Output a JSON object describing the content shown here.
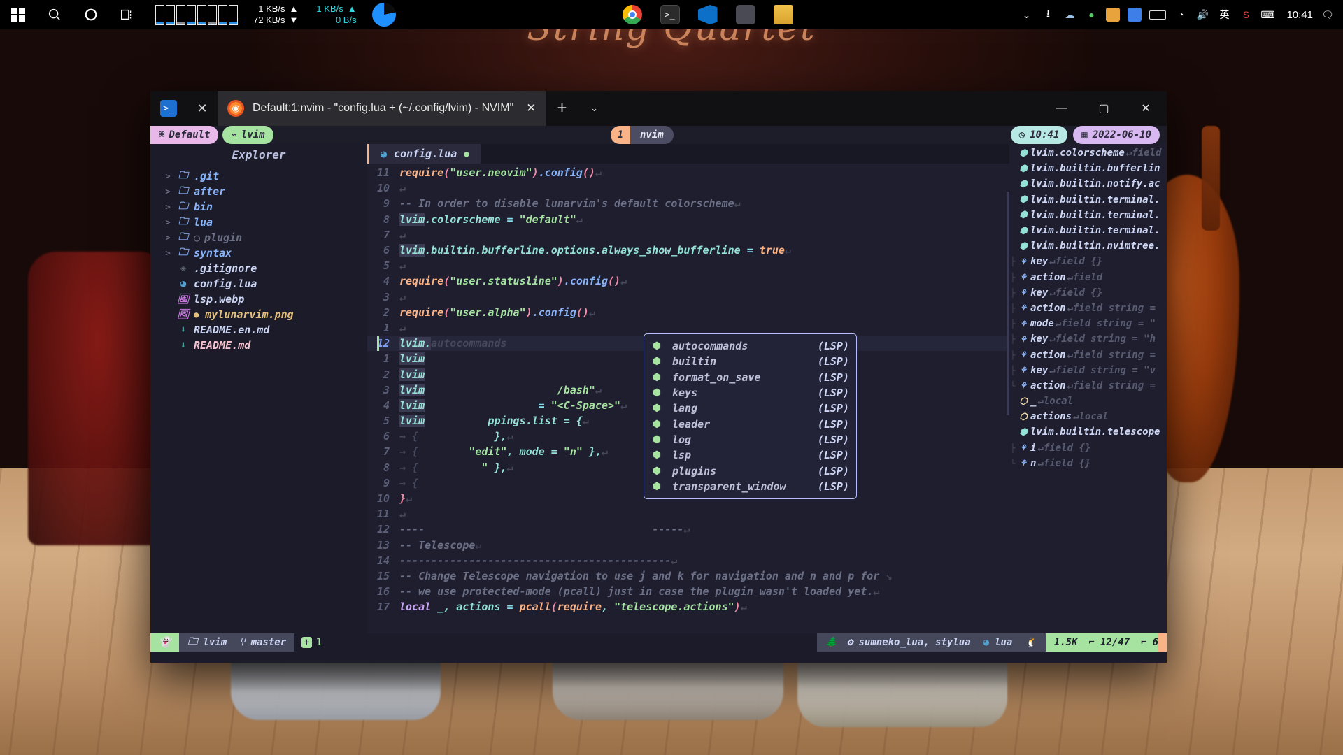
{
  "desktop": {
    "wallpaper_title": "String Quartet"
  },
  "taskbar": {
    "start_label": "⊞",
    "search_label": "search-icon",
    "cortana_label": "cortana-icon",
    "taskview_label": "task-view-icon",
    "net_down_value": "72 KB/s",
    "net_up_value": "1 KB/s",
    "net2_up_value": "1 KB/s",
    "net2_down_value": "0 B/s",
    "arrow_up": "▲",
    "arrow_down": "▼",
    "tray": {
      "chevron": "⌄",
      "ime_label": "英",
      "clock": "10:41"
    },
    "apps": [
      "chrome-icon",
      "terminal-icon",
      "vscode-icon",
      "book-icon",
      "files-icon"
    ]
  },
  "window": {
    "tab_title": "Default:1:nvim - \"config.lua + (~/.config/lvim) - NVIM\"",
    "tab_close": "✕",
    "left_close": "✕",
    "new_tab": "+",
    "dropdown": "⌄",
    "minimize": "—",
    "maximize": "▢",
    "close": "✕"
  },
  "tmux": {
    "session": "Default",
    "window_name": "lvim",
    "pane_number": "1",
    "pane_name": "nvim",
    "clock_icon": "clock-icon",
    "clock": "10:41",
    "date_icon": "calendar-icon",
    "date": "2022-06-10"
  },
  "explorer": {
    "title": "Explorer",
    "items": [
      {
        "arrow": ">",
        "icon": "folder-icon",
        "name": ".git",
        "type": "folder",
        "modified": false
      },
      {
        "arrow": ">",
        "icon": "folder-icon",
        "name": "after",
        "type": "folder",
        "modified": false
      },
      {
        "arrow": ">",
        "icon": "folder-icon",
        "name": "bin",
        "type": "folder",
        "modified": false
      },
      {
        "arrow": ">",
        "icon": "folder-icon",
        "name": "lua",
        "type": "folder",
        "modified": false
      },
      {
        "arrow": ">",
        "icon": "folder-icon",
        "name": "plugin",
        "type": "folder-dim",
        "modified": false,
        "badge": "○"
      },
      {
        "arrow": ">",
        "icon": "folder-icon",
        "name": "syntax",
        "type": "folder",
        "modified": false
      },
      {
        "arrow": "",
        "icon": "git-icon",
        "name": ".gitignore",
        "type": "file",
        "modified": false
      },
      {
        "arrow": "",
        "icon": "lua-icon",
        "name": "config.lua",
        "type": "file",
        "modified": false
      },
      {
        "arrow": "",
        "icon": "image-icon",
        "name": "lsp.webp",
        "type": "file",
        "modified": false
      },
      {
        "arrow": "",
        "icon": "image-icon",
        "name": "mylunarvim.png",
        "type": "file",
        "modified": true,
        "badge": "●"
      },
      {
        "arrow": "",
        "icon": "markdown-icon",
        "name": "README.en.md",
        "type": "file",
        "modified": false
      },
      {
        "arrow": "",
        "icon": "markdown-icon",
        "name": "README.md",
        "type": "file-pink",
        "modified": false
      }
    ]
  },
  "bufferline": {
    "icon": "lua-icon",
    "name": "config.lua",
    "modified_dot": "●"
  },
  "editor": {
    "lines": [
      {
        "num": "11",
        "segments": [
          {
            "t": "require",
            "c": "t-call"
          },
          {
            "t": "(",
            "c": "t-paren"
          },
          {
            "t": "\"user.neovim\"",
            "c": "t-str"
          },
          {
            "t": ")",
            "c": "t-paren"
          },
          {
            "t": ".",
            "c": "t-fn"
          },
          {
            "t": "config",
            "c": "t-fn"
          },
          {
            "t": "()",
            "c": "t-paren"
          },
          {
            "t": "↵",
            "c": "t-ws"
          }
        ]
      },
      {
        "num": "10",
        "segments": [
          {
            "t": "↵",
            "c": "t-ws"
          }
        ]
      },
      {
        "num": "9",
        "segments": [
          {
            "t": "-- In order to disable lunarvim's default colorscheme",
            "c": "t-com"
          },
          {
            "t": "↵",
            "c": "t-ws"
          }
        ]
      },
      {
        "num": "8",
        "segments": [
          {
            "t": "lvim",
            "c": "t-var hl-box"
          },
          {
            "t": ".colorscheme ",
            "c": "t-var"
          },
          {
            "t": "= ",
            "c": "t-op"
          },
          {
            "t": "\"default\"",
            "c": "t-str"
          },
          {
            "t": "↵",
            "c": "t-ws"
          }
        ]
      },
      {
        "num": "7",
        "segments": [
          {
            "t": "↵",
            "c": "t-ws"
          }
        ]
      },
      {
        "num": "6",
        "segments": [
          {
            "t": "lvim",
            "c": "t-var hl-box"
          },
          {
            "t": ".builtin.bufferline.options.always_show_bufferline ",
            "c": "t-var"
          },
          {
            "t": "= ",
            "c": "t-op"
          },
          {
            "t": "true",
            "c": "t-num"
          },
          {
            "t": "↵",
            "c": "t-ws"
          }
        ]
      },
      {
        "num": "5",
        "segments": [
          {
            "t": "↵",
            "c": "t-ws"
          }
        ]
      },
      {
        "num": "4",
        "segments": [
          {
            "t": "require",
            "c": "t-call"
          },
          {
            "t": "(",
            "c": "t-paren"
          },
          {
            "t": "\"user.statusline\"",
            "c": "t-str"
          },
          {
            "t": ")",
            "c": "t-paren"
          },
          {
            "t": ".",
            "c": "t-fn"
          },
          {
            "t": "config",
            "c": "t-fn"
          },
          {
            "t": "()",
            "c": "t-paren"
          },
          {
            "t": "↵",
            "c": "t-ws"
          }
        ]
      },
      {
        "num": "3",
        "segments": [
          {
            "t": "↵",
            "c": "t-ws"
          }
        ]
      },
      {
        "num": "2",
        "segments": [
          {
            "t": "require",
            "c": "t-call"
          },
          {
            "t": "(",
            "c": "t-paren"
          },
          {
            "t": "\"user.alpha\"",
            "c": "t-str"
          },
          {
            "t": ")",
            "c": "t-paren"
          },
          {
            "t": ".",
            "c": "t-fn"
          },
          {
            "t": "config",
            "c": "t-fn"
          },
          {
            "t": "()",
            "c": "t-paren"
          },
          {
            "t": "↵",
            "c": "t-ws"
          }
        ]
      },
      {
        "num": "1",
        "segments": [
          {
            "t": "↵",
            "c": "t-ws"
          }
        ]
      },
      {
        "num": "12",
        "current": true,
        "segments": [
          {
            "t": "lvim.",
            "c": "t-var hl-box"
          },
          {
            "t": "autocommands",
            "c": "t-ws ghost"
          }
        ]
      },
      {
        "num": "1",
        "segments": [
          {
            "t": "lvim",
            "c": "t-var hl-box"
          }
        ]
      },
      {
        "num": "2",
        "segments": [
          {
            "t": "lvim",
            "c": "t-var hl-box"
          }
        ]
      },
      {
        "num": "3",
        "segments": [
          {
            "t": "lvim",
            "c": "t-var hl-box"
          },
          {
            "t": "                     /bash\"",
            "c": "t-str"
          },
          {
            "t": "↵",
            "c": "t-ws"
          }
        ]
      },
      {
        "num": "4",
        "segments": [
          {
            "t": "lvim",
            "c": "t-var hl-box"
          },
          {
            "t": "                  = ",
            "c": "t-op"
          },
          {
            "t": "\"<C-Space>\"",
            "c": "t-str"
          },
          {
            "t": "↵",
            "c": "t-ws"
          }
        ]
      },
      {
        "num": "5",
        "segments": [
          {
            "t": "lvim",
            "c": "t-var hl-box"
          },
          {
            "t": "          ppings.list = {",
            "c": "t-var"
          },
          {
            "t": "↵",
            "c": "t-ws"
          }
        ]
      },
      {
        "num": "6",
        "segments": [
          {
            "t": "→ {",
            "c": "t-ws"
          },
          {
            "t": "            },",
            "c": "t-var"
          },
          {
            "t": "↵",
            "c": "t-ws"
          }
        ]
      },
      {
        "num": "7",
        "segments": [
          {
            "t": "→ {",
            "c": "t-ws"
          },
          {
            "t": "        \"edit\"",
            "c": "t-str"
          },
          {
            "t": ", mode = ",
            "c": "t-var"
          },
          {
            "t": "\"n\"",
            "c": "t-str"
          },
          {
            "t": " },",
            "c": "t-var"
          },
          {
            "t": "↵",
            "c": "t-ws"
          }
        ]
      },
      {
        "num": "8",
        "segments": [
          {
            "t": "→ {",
            "c": "t-ws"
          },
          {
            "t": "          \"",
            "c": "t-str"
          },
          {
            "t": " },",
            "c": "t-var"
          },
          {
            "t": "↵",
            "c": "t-ws"
          }
        ]
      },
      {
        "num": "9",
        "segments": [
          {
            "t": "→ {",
            "c": "t-ws"
          }
        ]
      },
      {
        "num": "10",
        "segments": [
          {
            "t": "}",
            "c": "t-paren"
          },
          {
            "t": "↵",
            "c": "t-ws"
          }
        ]
      },
      {
        "num": "11",
        "segments": [
          {
            "t": "↵",
            "c": "t-ws"
          }
        ]
      },
      {
        "num": "12",
        "segments": [
          {
            "t": "----",
            "c": "t-com"
          },
          {
            "t": "                                    -----",
            "c": "t-com"
          },
          {
            "t": "↵",
            "c": "t-ws"
          }
        ]
      },
      {
        "num": "13",
        "segments": [
          {
            "t": "-- Telescope",
            "c": "t-com"
          },
          {
            "t": "↵",
            "c": "t-ws"
          }
        ]
      },
      {
        "num": "14",
        "segments": [
          {
            "t": "-------------------------------------------",
            "c": "t-com"
          },
          {
            "t": "↵",
            "c": "t-ws"
          }
        ]
      },
      {
        "num": "15",
        "segments": [
          {
            "t": "-- Change Telescope navigation to use j and k for navigation and n and p for ",
            "c": "t-com"
          },
          {
            "t": "↘",
            "c": "t-ws"
          }
        ]
      },
      {
        "num": "16",
        "segments": [
          {
            "t": "-- we use protected-mode (pcall) just in case the plugin wasn't loaded yet.",
            "c": "t-com"
          },
          {
            "t": "↵",
            "c": "t-ws"
          }
        ]
      },
      {
        "num": "17",
        "segments": [
          {
            "t": "local",
            "c": "t-local"
          },
          {
            "t": " _, ",
            "c": "t-var"
          },
          {
            "t": "actions",
            "c": "t-var"
          },
          {
            "t": " = ",
            "c": "t-op"
          },
          {
            "t": "pcall",
            "c": "t-call"
          },
          {
            "t": "(",
            "c": "t-paren"
          },
          {
            "t": "require",
            "c": "t-call"
          },
          {
            "t": ", ",
            "c": "t-var"
          },
          {
            "t": "\"telescope.actions\"",
            "c": "t-str"
          },
          {
            "t": ")",
            "c": "t-paren"
          },
          {
            "t": "↵",
            "c": "t-ws"
          }
        ]
      }
    ]
  },
  "completion": {
    "items": [
      {
        "icon": "module-icon",
        "label": "autocommands",
        "kind": "(LSP)"
      },
      {
        "icon": "module-icon",
        "label": "builtin",
        "kind": "(LSP)"
      },
      {
        "icon": "module-icon",
        "label": "format_on_save",
        "kind": "(LSP)"
      },
      {
        "icon": "module-icon",
        "label": "keys",
        "kind": "(LSP)"
      },
      {
        "icon": "module-icon",
        "label": "lang",
        "kind": "(LSP)"
      },
      {
        "icon": "module-icon",
        "label": "leader",
        "kind": "(LSP)"
      },
      {
        "icon": "module-icon",
        "label": "log",
        "kind": "(LSP)"
      },
      {
        "icon": "module-icon",
        "label": "lsp",
        "kind": "(LSP)"
      },
      {
        "icon": "module-icon",
        "label": "plugins",
        "kind": "(LSP)"
      },
      {
        "icon": "module-icon",
        "label": "transparent_window",
        "kind": "(LSP)"
      }
    ]
  },
  "symbols": {
    "items": [
      {
        "guide": "",
        "icon": "module-icon",
        "name": "lvim.colorscheme",
        "detail": "field"
      },
      {
        "guide": "",
        "icon": "module-icon",
        "name": "lvim.builtin.bufferlin",
        "detail": ""
      },
      {
        "guide": "",
        "icon": "module-icon",
        "name": "lvim.builtin.notify.ac",
        "detail": ""
      },
      {
        "guide": "",
        "icon": "module-icon",
        "name": "lvim.builtin.terminal.",
        "detail": ""
      },
      {
        "guide": "",
        "icon": "module-icon",
        "name": "lvim.builtin.terminal.",
        "detail": ""
      },
      {
        "guide": "",
        "icon": "module-icon",
        "name": "lvim.builtin.terminal.",
        "detail": ""
      },
      {
        "guide": "",
        "icon": "module-icon",
        "name": "lvim.builtin.nvimtree.",
        "detail": ""
      },
      {
        "guide": "├",
        "icon": "field-icon",
        "name": "key",
        "detail": "field {}"
      },
      {
        "guide": "├",
        "icon": "field-icon",
        "name": "action",
        "detail": "field"
      },
      {
        "guide": "├",
        "icon": "field-icon",
        "name": "key",
        "detail": "field {}"
      },
      {
        "guide": "├",
        "icon": "field-icon",
        "name": "action",
        "detail": "field string ="
      },
      {
        "guide": "├",
        "icon": "field-icon",
        "name": "mode",
        "detail": "field string = \""
      },
      {
        "guide": "├",
        "icon": "field-icon",
        "name": "key",
        "detail": "field string = \"h"
      },
      {
        "guide": "├",
        "icon": "field-icon",
        "name": "action",
        "detail": "field string ="
      },
      {
        "guide": "├",
        "icon": "field-icon",
        "name": "key",
        "detail": "field string = \"v"
      },
      {
        "guide": "└",
        "icon": "field-icon",
        "name": "action",
        "detail": "field string ="
      },
      {
        "guide": "",
        "icon": "object-icon",
        "name": "_",
        "detail": "local"
      },
      {
        "guide": "",
        "icon": "object-icon",
        "name": "actions",
        "detail": "local"
      },
      {
        "guide": "",
        "icon": "module-icon",
        "name": "lvim.builtin.telescope",
        "detail": ""
      },
      {
        "guide": "├",
        "icon": "field-icon",
        "name": "i",
        "detail": "field {}"
      },
      {
        "guide": "└",
        "icon": "field-icon",
        "name": "n",
        "detail": "field {}"
      }
    ]
  },
  "statusline": {
    "mode_icon": "ghost-icon",
    "dir_icon": "folder-icon",
    "dir": "lvim",
    "branch_icon": "git-branch-icon",
    "branch": "master",
    "diff_icon": "diff-add-icon",
    "diff_count": "1",
    "tree_icon": "tree-icon",
    "lsp_icon": "gears-icon",
    "lsp_servers": "sumneko_lua, stylua",
    "filetype_icon": "lua-icon",
    "filetype": "lua",
    "os_icon": "linux-icon",
    "filesize": "1.5K",
    "line_icon": "line-icon",
    "position": "12/47",
    "col_icon": "col-icon",
    "column": "6"
  }
}
